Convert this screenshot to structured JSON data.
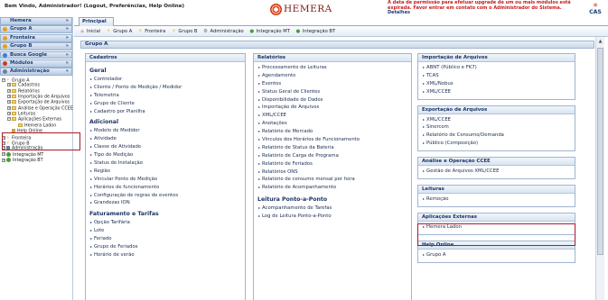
{
  "header": {
    "welcome": "Bem Vindo, Administrador! (Logout, Preferências, Help Online)",
    "logo_text": "HEMERA",
    "warning": "A data de permissão para efetuar upgrade de um ou mais módulos está expirada. Favor entrar em contato com o Administrador do Sistema.",
    "details": "Detalhes",
    "cas_logo": "CAS"
  },
  "sidebar": {
    "sections": [
      {
        "label": "Hemera",
        "icon": "none"
      },
      {
        "label": "Grupo A",
        "icon": "bolt-icon"
      },
      {
        "label": "Fronteira",
        "icon": "bolt-icon"
      },
      {
        "label": "Grupo B",
        "icon": "bolt-icon"
      },
      {
        "label": "Busca Google",
        "icon": "google-icon"
      },
      {
        "label": "Módulos",
        "icon": "modules-icon"
      },
      {
        "label": "Administração",
        "icon": "admin-icon"
      }
    ],
    "tree": [
      {
        "label": "Grupo A",
        "level": 0
      },
      {
        "label": "Cadastros",
        "level": 1
      },
      {
        "label": "Relatórios",
        "level": 1
      },
      {
        "label": "Importação de Arquivos",
        "level": 1
      },
      {
        "label": "Exportação de Arquivos",
        "level": 1
      },
      {
        "label": "Análise e Operação CCEE",
        "level": 1
      },
      {
        "label": "Leituras",
        "level": 1
      },
      {
        "label": "Aplicações Externas",
        "level": 1
      },
      {
        "label": "Hemera Ladon",
        "level": 2
      },
      {
        "label": "Help Online",
        "level": 1
      },
      {
        "label": "Fronteira",
        "level": 0
      },
      {
        "label": "Grupo B",
        "level": 0
      },
      {
        "label": "Administração",
        "level": 0
      },
      {
        "label": "Integração MT",
        "level": 0
      },
      {
        "label": "Integração BT",
        "level": 0
      }
    ]
  },
  "tabs": {
    "principal": "Principal"
  },
  "navbar": [
    {
      "label": "Inicial",
      "icon": "home-icon"
    },
    {
      "label": "Grupo A",
      "icon": "bolt-icon"
    },
    {
      "label": "Fronteira",
      "icon": "bolt-icon"
    },
    {
      "label": "Grupo B",
      "icon": "bolt-icon"
    },
    {
      "label": "Administração",
      "icon": "gear-icon"
    },
    {
      "label": "Integração MT",
      "icon": "integration-icon"
    },
    {
      "label": "Integração BT",
      "icon": "integration-icon"
    }
  ],
  "main": {
    "title": "Grupo A",
    "cadastros": {
      "title": "Cadastros",
      "groups": [
        {
          "title": "Geral",
          "links": [
            "Controlador",
            "Cliente / Ponto de Medição / Medidor",
            "Telemetria",
            "Grupo de Cliente",
            "Cadastro por Planilha"
          ]
        },
        {
          "title": "Adicional",
          "links": [
            "Modelo de Medidor",
            "Atividade",
            "Classe de Atividade",
            "Tipo de Medição",
            "Status de Instalação",
            "Região",
            "Vincular Ponto de Medição",
            "Horários de funcionamento",
            "Configuração de regras de eventos",
            "Grandezas ION"
          ]
        },
        {
          "title": "Faturamento e Tarifas",
          "links": [
            "Opção Tarifária",
            "Lote",
            "Feriado",
            "Grupo de Feriados",
            "Horário de verão"
          ]
        }
      ]
    },
    "relatorios": {
      "title": "Relatórios",
      "links": [
        "Processamento de Leituras",
        "Agendamento",
        "Eventos",
        "Status Geral de Clientes",
        "Disponibilidade de Dados",
        "Importação de Arquivos",
        "XML/CCEE",
        "Anotações",
        "Relatório de Mercado",
        "Vínculos dos Horários de Funcionamento",
        "Relatório de Status da Bateria",
        "Relatório de Carga de Programa",
        "Relatório de Feriados",
        "Relatórios ONS",
        "Relatório de consumo mensal por hora",
        "Relatório de Acompanhamento"
      ],
      "leitura_title": "Leitura Ponto-a-Ponto",
      "leitura_links": [
        "Acompanhamento de Tarefas",
        "Log de Leitura Ponto-a-Ponto"
      ]
    },
    "right_panels": [
      {
        "title": "Importação de Arquivos",
        "links": [
          "ABNT (Público e FK7)",
          "TCAS",
          "XML/Nobus",
          "XML/CCEE"
        ]
      },
      {
        "title": "Exportação de Arquivos",
        "links": [
          "XML/CCEE",
          "Sinercom",
          "Relatório de Consumo/Demanda",
          "Público (Composição)"
        ]
      },
      {
        "title": "Análise e Operação CCEE",
        "links": [
          "Gestão de Arquivos XML/CCEE"
        ]
      },
      {
        "title": "Leituras",
        "links": [
          "Remoção"
        ]
      },
      {
        "title": "Aplicações Externas",
        "links": [
          "Hemera Ladon"
        ]
      },
      {
        "title": "Help Online",
        "links": [
          "Grupo A"
        ]
      }
    ]
  },
  "colors": {
    "accent": "#1b3564",
    "highlight": "#a71b26",
    "warning": "#c81d1d"
  }
}
